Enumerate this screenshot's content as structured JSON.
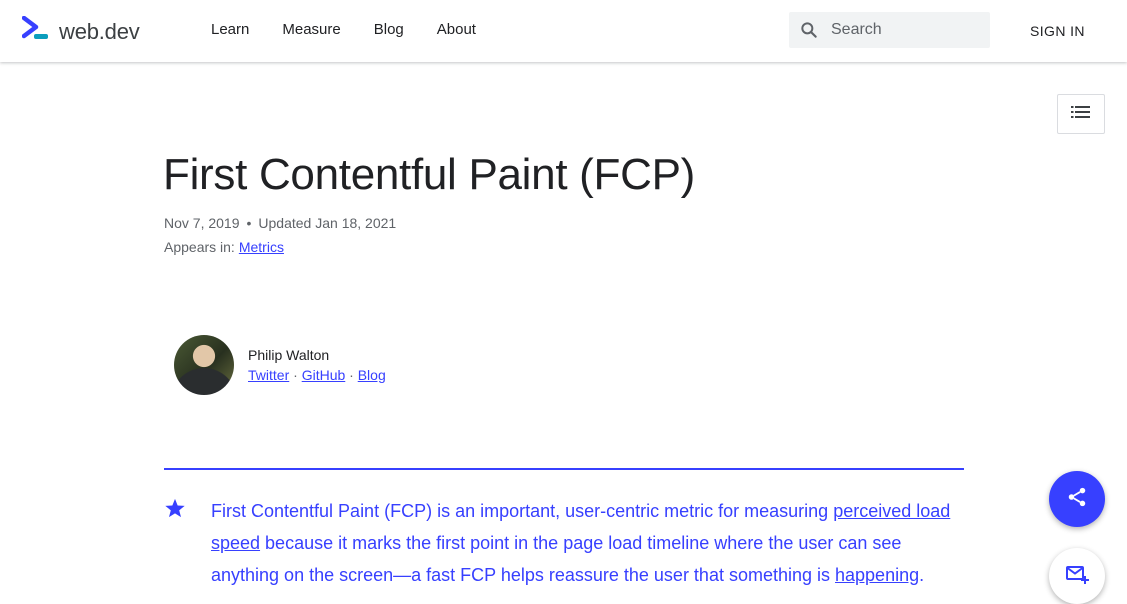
{
  "header": {
    "logo_text": "web.dev",
    "nav": [
      "Learn",
      "Measure",
      "Blog",
      "About"
    ],
    "search_placeholder": "Search",
    "signin_label": "SIGN IN"
  },
  "article": {
    "title": "First Contentful Paint (FCP)",
    "published": "Nov 7, 2019",
    "updated": "Updated Jan 18, 2021",
    "appears_label": "Appears in:",
    "appears_link": "Metrics",
    "author": {
      "name": "Philip Walton",
      "links": [
        "Twitter",
        "GitHub",
        "Blog"
      ]
    },
    "summary": {
      "part1": "First Contentful Paint (FCP) is an important, user-centric metric for measuring ",
      "link1": "perceived load speed",
      "part2": " because it marks the first point in the page load timeline where the user can see anything on the screen—a fast FCP helps reassure the user that something is ",
      "link2": "happening",
      "part3": "."
    }
  },
  "colors": {
    "accent": "#3740ff",
    "text": "#202124",
    "muted": "#5f6368"
  },
  "icons": [
    "web-dev-logo-icon",
    "search-icon",
    "toc-list-icon",
    "star-icon",
    "share-icon",
    "subscribe-mail-icon"
  ]
}
